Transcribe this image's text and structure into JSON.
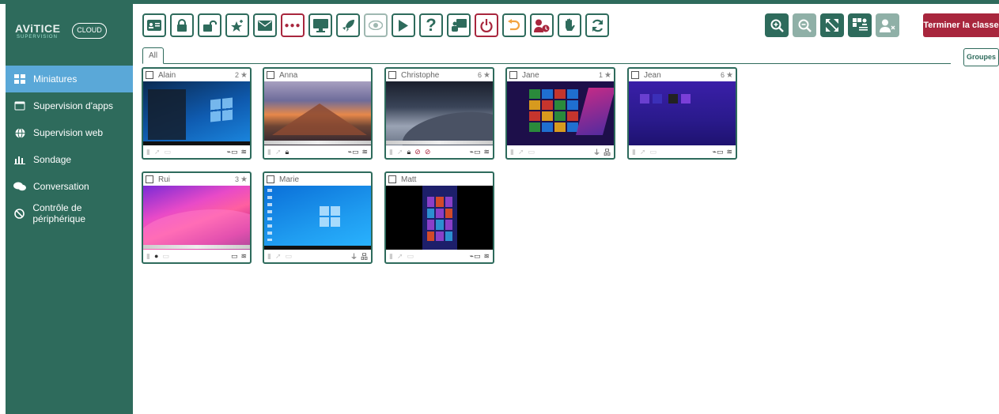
{
  "app": {
    "brand": "AViTICE",
    "brand_cloud": "CLOUD",
    "brand_sub": "SUPERVISION"
  },
  "sidebar": {
    "items": [
      {
        "label": "Miniatures",
        "icon": "grid-icon",
        "active": true
      },
      {
        "label": "Supervision d'apps",
        "icon": "window-icon",
        "active": false
      },
      {
        "label": "Supervision web",
        "icon": "globe-icon",
        "active": false
      },
      {
        "label": "Sondage",
        "icon": "bar-chart-icon",
        "active": false
      },
      {
        "label": "Conversation",
        "icon": "chat-icon",
        "active": false
      },
      {
        "label": "Contrôle de périphérique",
        "icon": "block-icon",
        "active": false
      }
    ]
  },
  "toolbar": {
    "buttons": [
      "id-card-icon",
      "lock-icon",
      "unlock-icon",
      "star-add-icon",
      "mail-icon",
      "dots-icon",
      "monitor-icon",
      "rocket-icon",
      "eye-icon",
      "play-icon",
      "question-icon",
      "presentation-icon",
      "power-icon",
      "undo-icon",
      "user-clock-icon",
      "hand-icon",
      "refresh-icon"
    ],
    "end_class_label": "Terminer la classe",
    "right_buttons": [
      "zoom-in-icon",
      "zoom-out-icon",
      "fullscreen-icon",
      "layout-grid-icon",
      "user-remove-icon"
    ]
  },
  "tabs": {
    "all_label": "All",
    "groups_label": "Groupes"
  },
  "students": [
    {
      "name": "Alain",
      "count": "2",
      "screen": "win10"
    },
    {
      "name": "Anna",
      "count": "",
      "screen": "mac-mtn"
    },
    {
      "name": "Christophe",
      "count": "6",
      "screen": "mojave"
    },
    {
      "name": "Jane",
      "count": "1",
      "screen": "win8"
    },
    {
      "name": "Jean",
      "count": "6",
      "screen": "win8b"
    },
    {
      "name": "Rui",
      "count": "3",
      "screen": "monterey"
    },
    {
      "name": "Marie",
      "count": "",
      "screen": "win10b"
    },
    {
      "name": "Matt",
      "count": "",
      "screen": "win8c"
    }
  ],
  "colors": {
    "primary": "#2e6b5c",
    "accent_active": "#5aa8d8",
    "danger": "#a8263d"
  }
}
